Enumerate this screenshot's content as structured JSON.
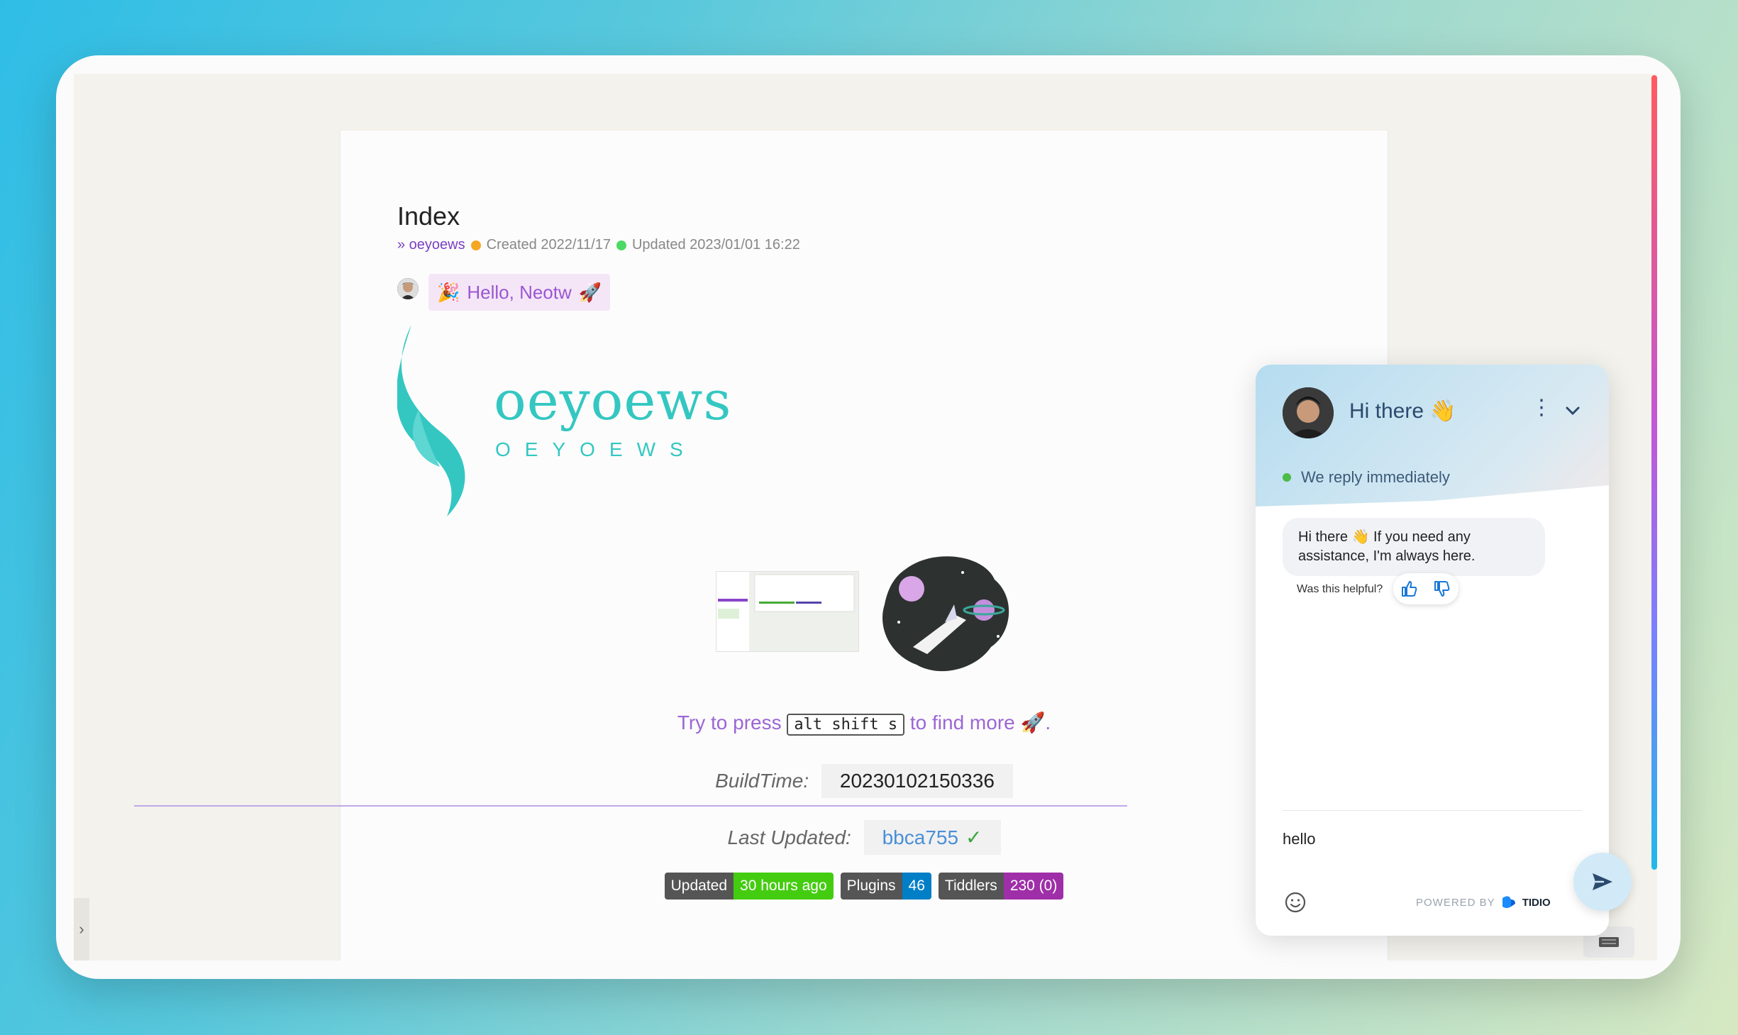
{
  "page": {
    "title": "Index",
    "breadcrumb": "» oeyoews",
    "created": "Created 2022/11/17",
    "updated": "Updated 2023/01/01 16:22",
    "greeting": "Hello, Neotw"
  },
  "logo": {
    "word": "oeyoews",
    "sub": "OEYOEWS"
  },
  "tip": {
    "before": "Try to press",
    "key": "alt shift s",
    "after": "to find more",
    "end": "."
  },
  "build": {
    "label": "BuildTime:",
    "value": "20230102150336"
  },
  "last_updated": {
    "label": "Last Updated:",
    "hash": "bbca755",
    "check": "✓"
  },
  "badges": [
    {
      "key": "Updated",
      "value": "30 hours ago",
      "color": "#44cc11"
    },
    {
      "key": "Plugins",
      "value": "46",
      "color": "#007ec6"
    },
    {
      "key": "Tiddlers",
      "value": "230 (0)",
      "color": "#9f2fa8"
    }
  ],
  "chat": {
    "title": "Hi there 👋",
    "status": "We reply immediately",
    "message_line1": "Hi there 👋 If you need any",
    "message_line2": "assistance, I'm always here.",
    "helpful": "Was this helpful?",
    "input_value": "hello",
    "powered_by": "POWERED BY",
    "brand": "TIDIO"
  },
  "colors": {
    "accent": "#9b57d3",
    "logo": "#34c7c2",
    "orange_dot": "#f5a623",
    "green_dot": "#4cd964"
  }
}
